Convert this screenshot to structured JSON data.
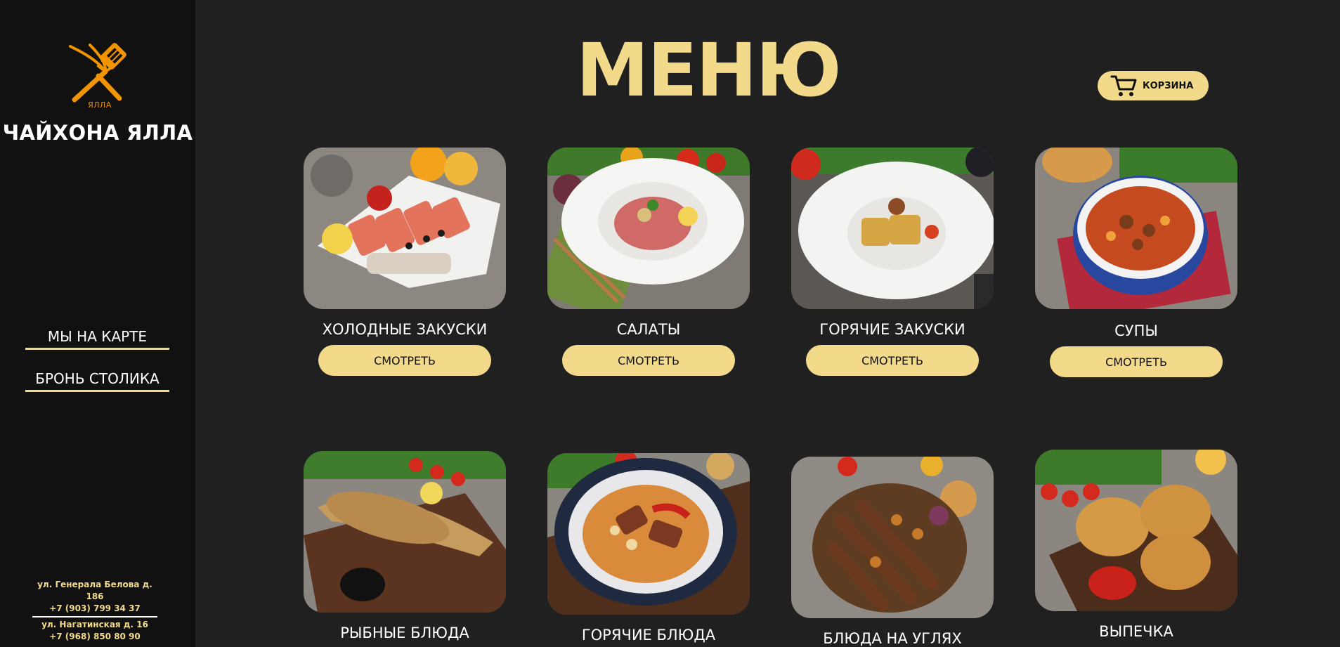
{
  "sidebar": {
    "logo_text": "ЯЛЛА",
    "brand": "ЧАЙХОНА ЯЛЛА",
    "links": [
      {
        "label": "МЫ НА КАРТЕ"
      },
      {
        "label": "БРОНЬ СТОЛИКА"
      }
    ],
    "contacts": [
      {
        "address": "ул. Генерала Белова д. 186",
        "phone": "+7 (903) 799 34 37"
      },
      {
        "address": "ул. Нагатинская д. 16",
        "phone": "+7 (968) 850 80 90"
      }
    ]
  },
  "header": {
    "title": "МЕНЮ",
    "cart_label": "КОРЗИНА"
  },
  "menu": {
    "button_label": "СМОТРЕТЬ",
    "categories": [
      {
        "title": "ХОЛОДНЫЕ ЗАКУСКИ",
        "image": "cold-appetizers-photo"
      },
      {
        "title": "САЛАТЫ",
        "image": "salads-photo"
      },
      {
        "title": "ГОРЯЧИЕ ЗАКУСКИ",
        "image": "hot-appetizers-photo"
      },
      {
        "title": "СУПЫ",
        "image": "soups-photo"
      },
      {
        "title": "РЫБНЫЕ БЛЮДА",
        "image": "fish-dishes-photo"
      },
      {
        "title": "ГОРЯЧИЕ БЛЮДА",
        "image": "hot-dishes-photo"
      },
      {
        "title": "БЛЮДА НА УГЛЯХ",
        "image": "grill-dishes-photo"
      },
      {
        "title": "ВЫПЕЧКА",
        "image": "pastry-photo"
      }
    ]
  },
  "colors": {
    "accent": "#f2da8a",
    "logo": "#f29400",
    "sidebar_bg": "#111111",
    "page_bg": "#202020"
  }
}
